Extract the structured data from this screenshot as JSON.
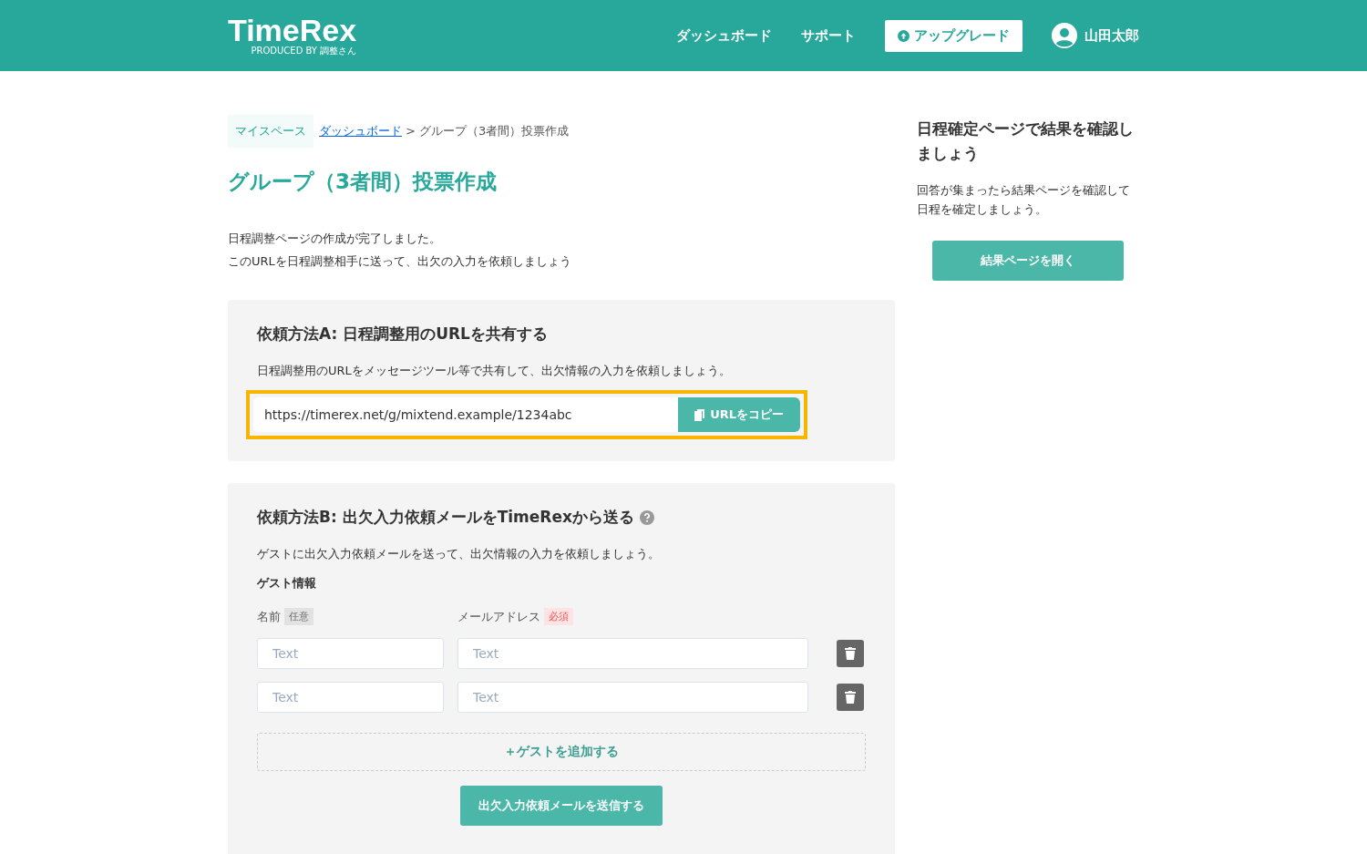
{
  "header": {
    "logo": "TimeRex",
    "logo_sub": "PRODUCED BY 調整さん",
    "nav": [
      "ダッシュボード",
      "サポート"
    ],
    "upgrade": "アップグレード",
    "user": "山田太郎"
  },
  "breadcrumb": {
    "home": "マイスペース",
    "link": "ダッシュボード",
    "current": "> グループ（3者間）投票作成"
  },
  "title": "グループ（3者間）投票作成",
  "intro": [
    "日程調整ページの作成が完了しました。",
    "このURLを日程調整相手に送って、出欠の入力を依頼しましょう"
  ],
  "method_a": {
    "title": "依頼方法A: 日程調整用のURLを共有する",
    "description": "日程調整用のURLをメッセージツール等で共有して、出欠情報の入力を依頼しましょう。",
    "url": "https://timerex.net/g/mixtend.example/1234abc",
    "copy_button": "URLをコピー"
  },
  "method_b": {
    "title": "依頼方法B: 出欠入力依頼メールをTimeRexから送る",
    "description": "ゲストに出欠入力依頼メールを送って、出欠情報の入力を依頼しましょう。",
    "section": "ゲスト情報",
    "columns": [
      {
        "label": "名前",
        "badge": "任意",
        "required": false
      },
      {
        "label": "メールアドレス",
        "badge": "必須",
        "required": true
      }
    ],
    "guests": [
      {
        "name_placeholder": "Text",
        "email_placeholder": "Text"
      },
      {
        "name_placeholder": "Text",
        "email_placeholder": "Text"
      }
    ],
    "add_button": "＋ゲストを追加する",
    "send_button": "出欠入力依頼メールを送信する"
  },
  "sidebar": {
    "title": "日程確定ページで結果を確認しましょう",
    "description": "回答が集まったら結果ページを確認して日程を確定しましょう。",
    "button": "結果ページを開く"
  }
}
